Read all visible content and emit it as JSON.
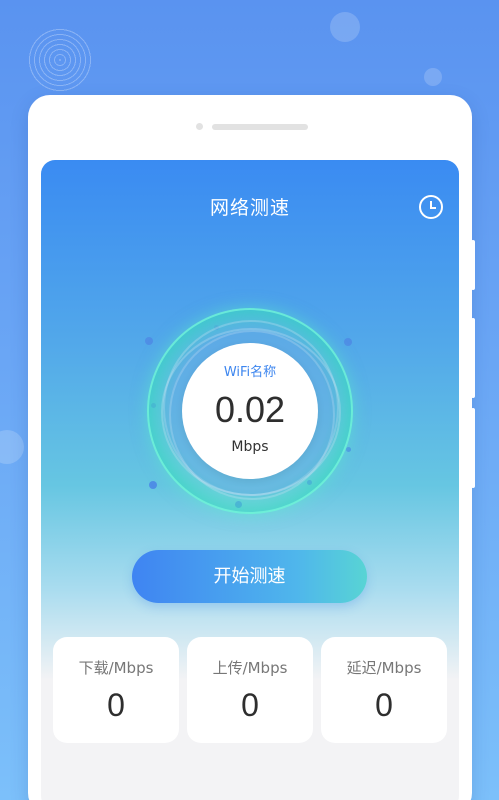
{
  "header": {
    "title": "网络测速"
  },
  "icons": {
    "history": "clock-icon"
  },
  "gauge": {
    "wifi_name": "WiFi名称",
    "speed": "0.02",
    "unit": "Mbps"
  },
  "actions": {
    "start_label": "开始测速"
  },
  "stats": [
    {
      "label": "下载/Mbps",
      "value": "0"
    },
    {
      "label": "上传/Mbps",
      "value": "0"
    },
    {
      "label": "延迟/Mbps",
      "value": "0"
    }
  ],
  "colors": {
    "accent": "#3d86ef",
    "button_start": "#3f84f2",
    "button_end": "#58d4d4",
    "ring": "#5ef0c8"
  }
}
